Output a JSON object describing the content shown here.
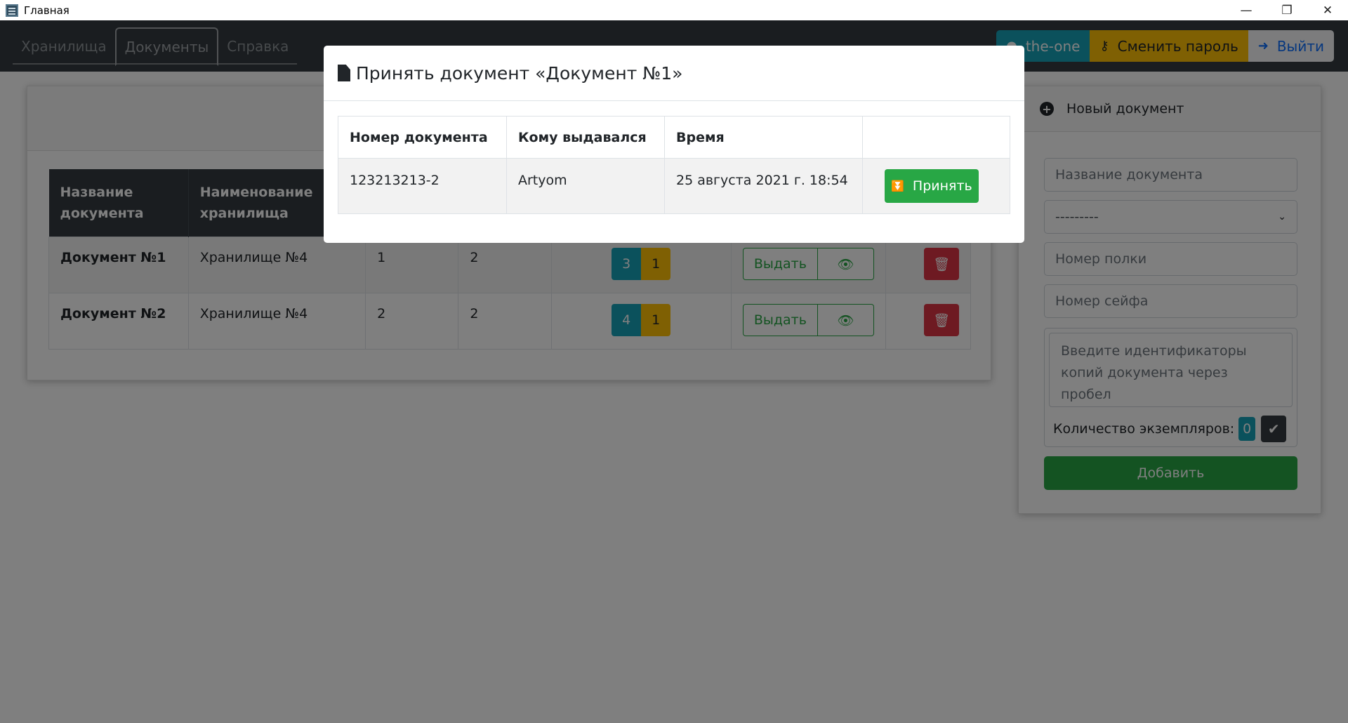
{
  "window": {
    "title": "Главная",
    "minimize": "—",
    "restore": "❐",
    "close": "✕"
  },
  "navbar": {
    "tabs": [
      "Хранилища",
      "Документы",
      "Справка"
    ],
    "active_tab": "Документы",
    "user": "the-one",
    "change_password": "Сменить пароль",
    "logout": "Выйти"
  },
  "documents_table": {
    "headers": [
      "Название документа",
      "Наименование хранилища",
      "",
      "",
      "",
      "",
      ""
    ],
    "rows": [
      {
        "name": "Документ №1",
        "storage": "Хранилище №4",
        "shelf": "1",
        "safe": "2",
        "total": "3",
        "issued": "1",
        "issue_label": "Выдать"
      },
      {
        "name": "Документ №2",
        "storage": "Хранилище №4",
        "shelf": "2",
        "safe": "2",
        "total": "4",
        "issued": "1",
        "issue_label": "Выдать"
      }
    ]
  },
  "new_document": {
    "title": "Новый документ",
    "name_placeholder": "Название документа",
    "storage_select_value": "---------",
    "shelf_placeholder": "Номер полки",
    "safe_placeholder": "Номер сейфа",
    "copies_placeholder": "Введите идентификаторы копий документа через пробел",
    "quantity_label": "Количество экземпляров:",
    "quantity_value": "0",
    "add_label": "Добавить"
  },
  "modal": {
    "title": "Принять документ «Документ №1»",
    "headers": [
      "Номер документа",
      "Кому выдавался",
      "Время",
      ""
    ],
    "rows": [
      {
        "number": "123213213-2",
        "to": "Artyom",
        "time": "25 августа 2021 г. 18:54",
        "action": "Принять"
      }
    ]
  },
  "colors": {
    "navbar": "#343a40",
    "info": "#17a2b8",
    "warning": "#ffc107",
    "success": "#28a745",
    "danger": "#dc3545"
  }
}
